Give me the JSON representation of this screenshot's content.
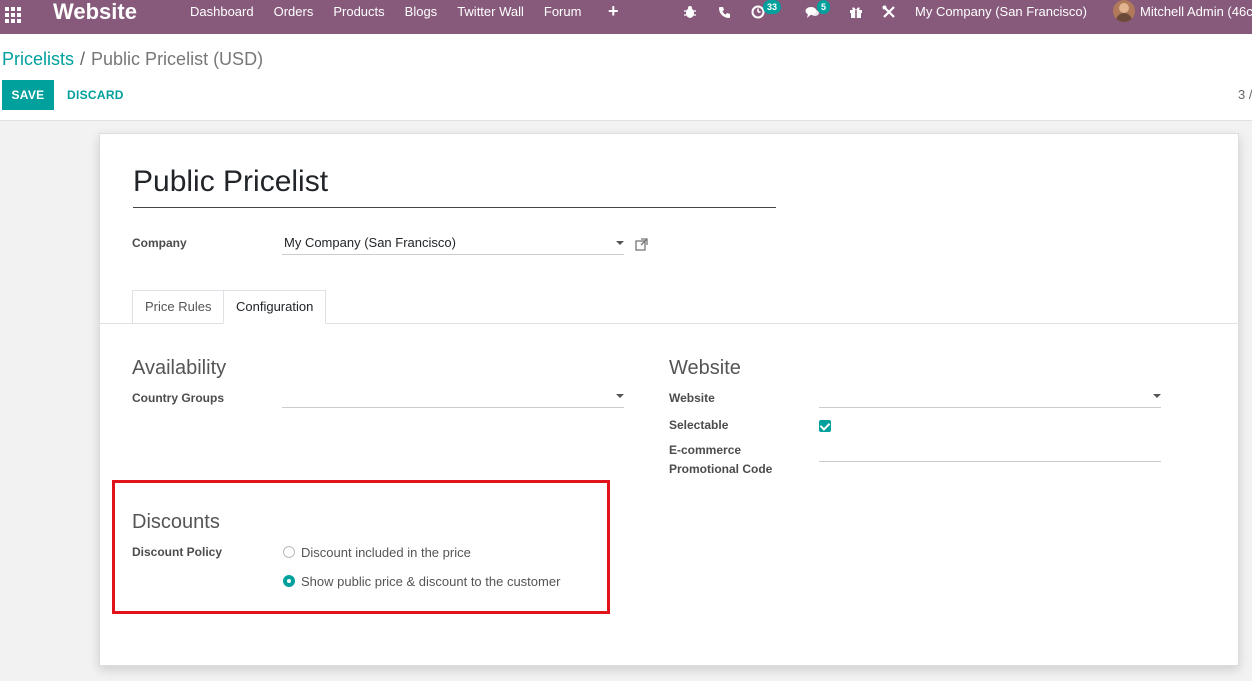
{
  "navbar": {
    "brand": "Website",
    "menu": [
      "Dashboard",
      "Orders",
      "Products",
      "Blogs",
      "Twitter Wall",
      "Forum"
    ],
    "plus": "+",
    "activity_count": "33",
    "messages_count": "5",
    "company": "My Company (San Francisco)",
    "user": "Mitchell Admin (46c"
  },
  "breadcrumb": {
    "parent": "Pricelists",
    "separator": "/",
    "current": "Public Pricelist (USD)"
  },
  "actions": {
    "save": "SAVE",
    "discard": "DISCARD"
  },
  "pager": "3 /",
  "form": {
    "name": "Public Pricelist",
    "company_label": "Company",
    "company_value": "My Company (San Francisco)",
    "tabs": [
      "Price Rules",
      "Configuration"
    ],
    "active_tab": "Configuration",
    "availability": {
      "title": "Availability",
      "country_groups_label": "Country Groups",
      "country_groups_value": ""
    },
    "website": {
      "title": "Website",
      "website_label": "Website",
      "website_value": "",
      "selectable_label": "Selectable",
      "selectable_checked": true,
      "promo_label_line1": "E-commerce",
      "promo_label_line2": "Promotional Code",
      "promo_value": ""
    },
    "discounts": {
      "title": "Discounts",
      "policy_label": "Discount Policy",
      "options": [
        {
          "label": "Discount included in the price",
          "checked": false
        },
        {
          "label": "Show public price & discount to the customer",
          "checked": true
        }
      ]
    }
  },
  "colors": {
    "navbar": "#875a7b",
    "accent": "#00a09d",
    "highlight": "#e0131a"
  }
}
